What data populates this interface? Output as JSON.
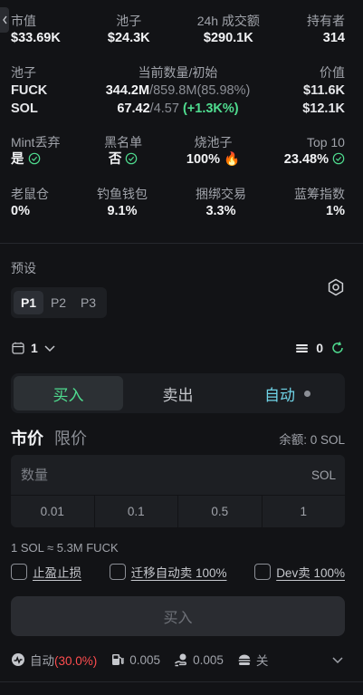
{
  "stats": [
    {
      "label": "市值",
      "value": "$33.69K"
    },
    {
      "label": "池子",
      "value": "$24.3K"
    },
    {
      "label": "24h 成交额",
      "value": "$290.1K"
    },
    {
      "label": "持有者",
      "value": "314"
    }
  ],
  "pool": {
    "headers": {
      "pool": "池子",
      "amount": "当前数量/初始",
      "value": "价值"
    },
    "rows": [
      {
        "name": "FUCK",
        "current": "344.2M",
        "initial": "/859.8M",
        "pct": "(85.98%)",
        "value": "$11.6K"
      },
      {
        "name": "SOL",
        "current": "67.42",
        "initial": "/4.57",
        "pct": "(+1.3K%)",
        "value": "$12.1K"
      }
    ]
  },
  "security": [
    {
      "label": "Mint丢弃",
      "value": "是"
    },
    {
      "label": "黑名单",
      "value": "否"
    },
    {
      "label": "烧池子",
      "value": "100%",
      "emoji": "🔥"
    },
    {
      "label": "Top 10",
      "value": "23.48%"
    }
  ],
  "holders": [
    {
      "label": "老鼠仓",
      "value": "0%"
    },
    {
      "label": "钓鱼钱包",
      "value": "9.1%"
    },
    {
      "label": "捆绑交易",
      "value": "3.3%"
    },
    {
      "label": "蓝筹指数",
      "value": "1%"
    }
  ],
  "preset": {
    "label": "预设",
    "tabs": [
      "P1",
      "P2",
      "P3"
    ],
    "active": "P1"
  },
  "wallet": {
    "count": "1",
    "queue": "0"
  },
  "modes": {
    "buy": "买入",
    "sell": "卖出",
    "auto": "自动"
  },
  "order": {
    "market": "市价",
    "limit": "限价",
    "balance": "余额: 0 SOL"
  },
  "amount": {
    "placeholder": "数量",
    "unit": "SOL",
    "quick": [
      "0.01",
      "0.1",
      "0.5",
      "1"
    ]
  },
  "rate": "1 SOL ≈ 5.3M FUCK",
  "options": [
    "止盈止损",
    "迁移自动卖 100%",
    "Dev卖 100%"
  ],
  "buy_button": "买入",
  "footer": {
    "auto_label": "自动",
    "auto_pct": "(30.0%)",
    "priority_fee": "0.005",
    "tip_fee": "0.005",
    "mev_label": "关"
  },
  "colors": {
    "green": "#4fdc8f",
    "red": "#ff4d4f",
    "cyan": "#6fd3e6",
    "background": "#121316"
  }
}
